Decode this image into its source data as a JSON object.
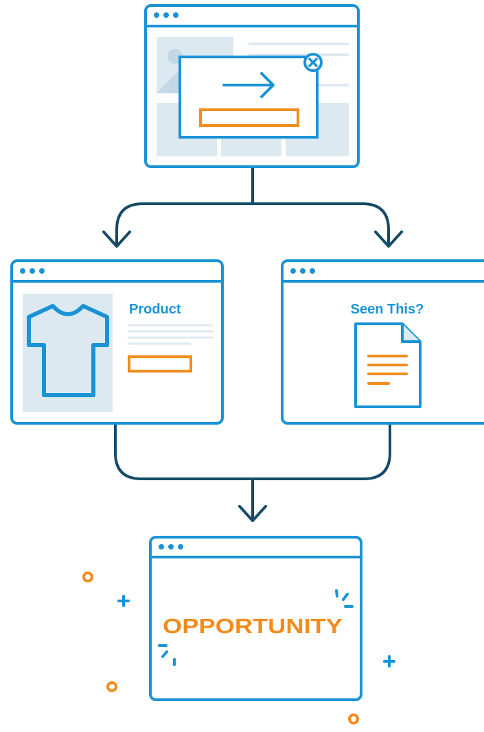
{
  "colors": {
    "primary": "#1a93d6",
    "connector": "#154a68",
    "accent": "#f28c1c",
    "fill": "#dce9f1",
    "background": "#ffffff"
  },
  "windows": {
    "popup": {
      "icon": "arrow-right-icon",
      "close_icon": "close-icon"
    },
    "product": {
      "label": "Product",
      "icon": "tshirt-icon"
    },
    "seen_this": {
      "label": "Seen This?",
      "icon": "document-icon"
    },
    "opportunity": {
      "label": "OPPORTUNITY"
    }
  },
  "decorations": [
    "circle-icon",
    "plus-icon",
    "sparkle-icon"
  ]
}
